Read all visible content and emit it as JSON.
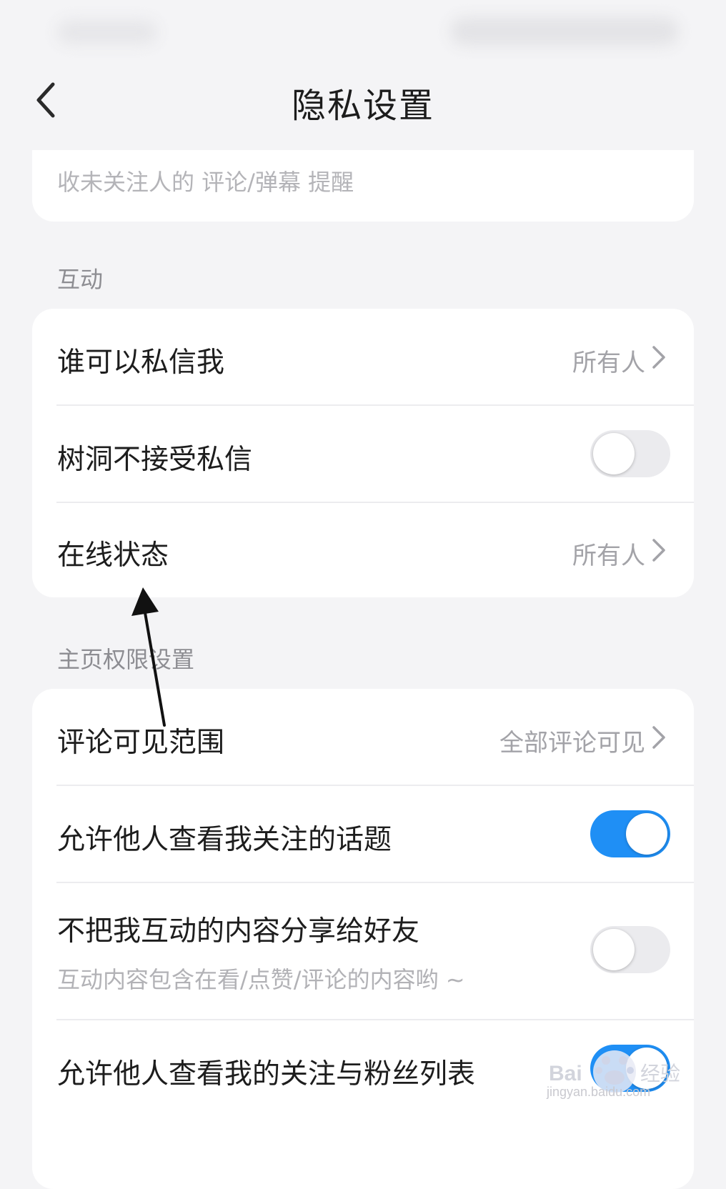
{
  "header": {
    "title": "隐私设置"
  },
  "top_card": {
    "text": "收未关注人的 评论/弹幕 提醒"
  },
  "sections": {
    "interaction": {
      "label": "互动",
      "rows": {
        "dm": {
          "label": "谁可以私信我",
          "value": "所有人"
        },
        "treehole": {
          "label": "树洞不接受私信",
          "toggle_on": false
        },
        "online": {
          "label": "在线状态",
          "value": "所有人"
        }
      }
    },
    "homepage": {
      "label": "主页权限设置",
      "rows": {
        "comments": {
          "label": "评论可见范围",
          "value": "全部评论可见"
        },
        "topics": {
          "label": "允许他人查看我关注的话题",
          "toggle_on": true
        },
        "share": {
          "label": "不把我互动的内容分享给好友",
          "sublabel": "互动内容包含在看/点赞/评论的内容哟 ~",
          "toggle_on": false
        },
        "follow_list": {
          "label": "允许他人查看我的关注与粉丝列表",
          "toggle_on": true
        }
      }
    }
  },
  "watermark": {
    "logo": "Baidu经验",
    "url": "jingyan.baidu.com"
  },
  "colors": {
    "accent": "#1f8ff5",
    "background": "#f4f4f6",
    "card": "#ffffff"
  }
}
